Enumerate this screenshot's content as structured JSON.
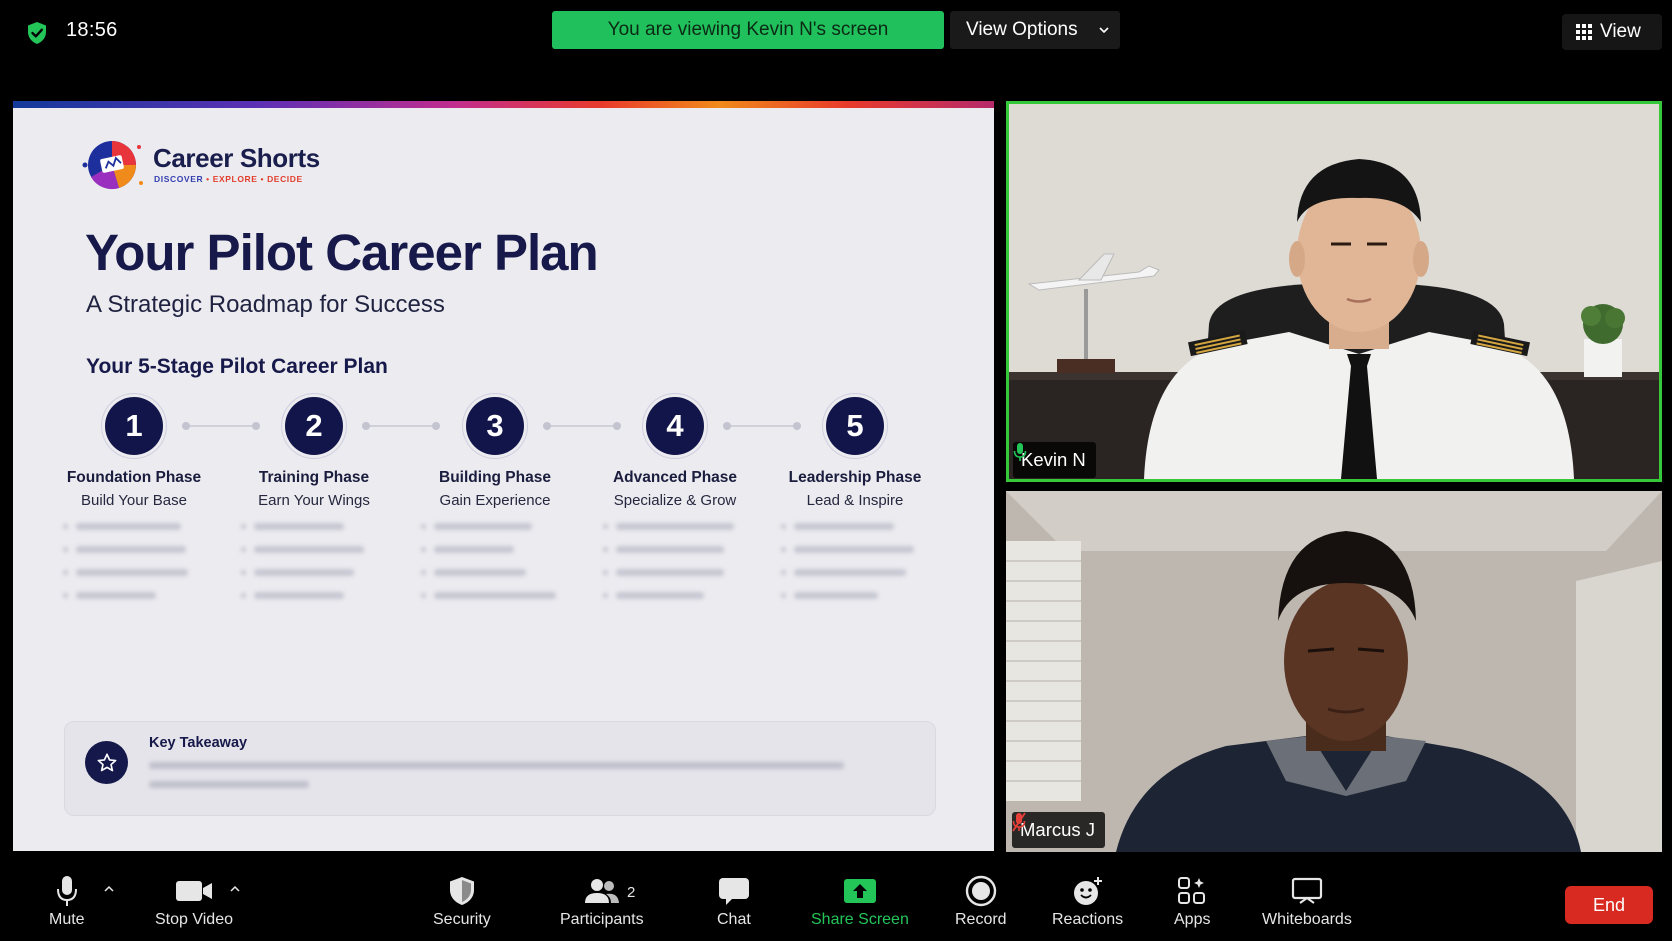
{
  "top_bar": {
    "time": "18:56",
    "viewing_banner": "You are viewing Kevin N's screen",
    "view_options_label": "View Options",
    "view_label": "View"
  },
  "slide": {
    "brand_name": "Career Shorts",
    "brand_tagline": [
      "DISCOVER",
      "EXPLORE",
      "DECIDE"
    ],
    "title": "Your Pilot Career Plan",
    "subtitle": "A Strategic Roadmap for Success",
    "stages_heading": "Your 5-Stage Pilot Career Plan",
    "stages": [
      {
        "number": "1",
        "name": "Foundation Phase",
        "description": "Build Your Base"
      },
      {
        "number": "2",
        "name": "Training Phase",
        "description": "Earn Your Wings"
      },
      {
        "number": "3",
        "name": "Building Phase",
        "description": "Gain Experience"
      },
      {
        "number": "4",
        "name": "Advanced Phase",
        "description": "Specialize & Grow"
      },
      {
        "number": "5",
        "name": "Leadership Phase",
        "description": "Lead & Inspire"
      }
    ],
    "takeaway_title": "Key Takeaway",
    "accent_color": "#11154a"
  },
  "participants": [
    {
      "name": "Kevin N",
      "mic": "on",
      "active_speaker": true
    },
    {
      "name": "Marcus J",
      "mic": "muted",
      "active_speaker": false
    }
  ],
  "toolbar": {
    "mute": "Mute",
    "stop_video": "Stop Video",
    "security": "Security",
    "participants": "Participants",
    "participants_count": "2",
    "chat": "Chat",
    "share_screen": "Share Screen",
    "record": "Record",
    "reactions": "Reactions",
    "apps": "Apps",
    "whiteboards": "Whiteboards",
    "end": "End",
    "share_color": "#23c559",
    "end_color": "#d92a22"
  }
}
